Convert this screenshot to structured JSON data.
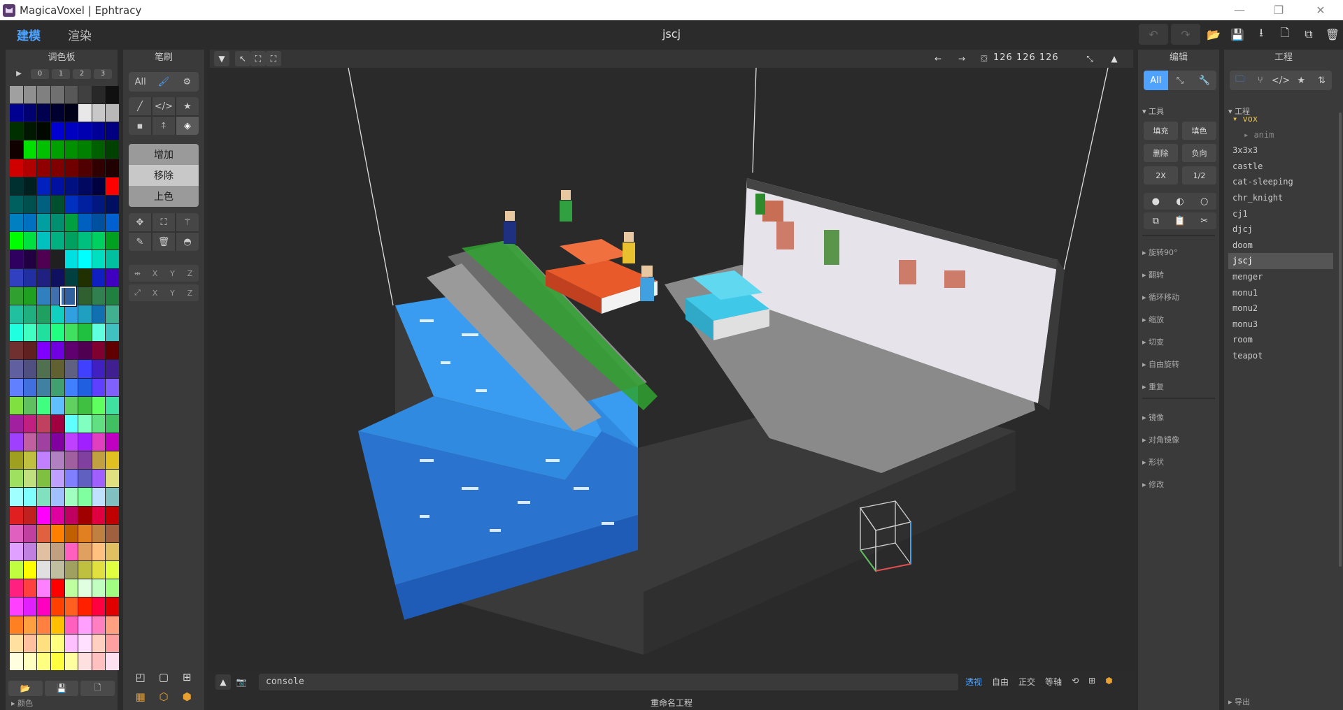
{
  "window": {
    "title": "MagicaVoxel | Ephtracy",
    "controls": [
      "—",
      "❐",
      "✕"
    ]
  },
  "topbar": {
    "tabs": [
      {
        "label": "建模",
        "active": true
      },
      {
        "label": "渲染",
        "active": false
      }
    ],
    "project_name": "jscj",
    "actions": [
      "↶",
      "↷",
      "📂",
      "💾",
      "⭳",
      "🗋",
      "⧉",
      "🗑"
    ]
  },
  "palette": {
    "title": "调色板",
    "tabs": [
      "▶",
      "0",
      "1",
      "2",
      "3"
    ],
    "footer_label": "颜色",
    "bottom_icons": [
      "📂",
      "💾",
      "🗋"
    ],
    "colors": [
      "#a0a0a0",
      "#909090",
      "#808080",
      "#707070",
      "#585858",
      "#404040",
      "#282828",
      "#101010",
      "#000090",
      "#000070",
      "#000050",
      "#000030",
      "#000018",
      "#e8e8e8",
      "#c8c8c8",
      "#b8b8b8",
      "#003000",
      "#001800",
      "#000800",
      "#0000d0",
      "#0000c0",
      "#0000b0",
      "#000098",
      "#000080",
      "#100000",
      "#00e000",
      "#00c000",
      "#00a000",
      "#009000",
      "#008000",
      "#006000",
      "#004000",
      "#d00000",
      "#b00000",
      "#900000",
      "#800000",
      "#700000",
      "#500000",
      "#300000",
      "#200000",
      "#003030",
      "#002020",
      "#0020c0",
      "#0010a0",
      "#001080",
      "#000860",
      "#000040",
      "#ff0000",
      "#006060",
      "#005050",
      "#006080",
      "#005030",
      "#0030c0",
      "#0020a0",
      "#001880",
      "#001060",
      "#0080c0",
      "#0070c0",
      "#00a0a0",
      "#009070",
      "#00a040",
      "#0060c0",
      "#0050a0",
      "#0060d0",
      "#00ff00",
      "#00e040",
      "#00c0c0",
      "#00b080",
      "#00a060",
      "#00c080",
      "#00d060",
      "#00a020",
      "#300060",
      "#200040",
      "#500050",
      "#202020",
      "#00e0e0",
      "#00ffff",
      "#00e0c0",
      "#00c0a0",
      "#3040c0",
      "#2030a0",
      "#202080",
      "#101060",
      "#004040",
      "#203000",
      "#1020c0",
      "#4000c0",
      "#30a030",
      "#20a020",
      "#3080c0",
      "#4070b0",
      "#3060a0",
      "#306030",
      "#308050",
      "#208040",
      "#20c0a0",
      "#20b080",
      "#20a060",
      "#10d0c0",
      "#30a0e0",
      "#20a0c0",
      "#1070b0",
      "#40b090",
      "#20ffe0",
      "#40ffc0",
      "#20e0a0",
      "#20ff80",
      "#40e060",
      "#20c040",
      "#60ffe0",
      "#40c0c0",
      "#703030",
      "#602020",
      "#8000ff",
      "#7000e0",
      "#600070",
      "#500050",
      "#800030",
      "#600000",
      "#6060a0",
      "#505080",
      "#507050",
      "#606030",
      "#606080",
      "#4040ff",
      "#4020c0",
      "#402090",
      "#6080ff",
      "#4070e0",
      "#4080a0",
      "#40a070",
      "#4080ff",
      "#2060e0",
      "#6040ff",
      "#8060ff",
      "#80e040",
      "#60c060",
      "#40ff80",
      "#60c0ff",
      "#60d060",
      "#40c040",
      "#60ff60",
      "#40e0a0",
      "#a020a0",
      "#c02080",
      "#c04060",
      "#a00040",
      "#60ffff",
      "#80ffc0",
      "#60e080",
      "#40c060",
      "#a040ff",
      "#c060a0",
      "#a040a0",
      "#8000a0",
      "#c040ff",
      "#a020ff",
      "#e040c0",
      "#c000c0",
      "#a0a020",
      "#c0c040",
      "#c080ff",
      "#b080c0",
      "#a060a0",
      "#8040a0",
      "#c0a040",
      "#e0c020",
      "#a0e060",
      "#c0e080",
      "#80c040",
      "#c0a0ff",
      "#8080ff",
      "#6060c0",
      "#a060ff",
      "#e0e080",
      "#a0ffff",
      "#80ffff",
      "#80e0c0",
      "#a0c0ff",
      "#a0ffc0",
      "#80ffa0",
      "#c0e0ff",
      "#80c0c0",
      "#e02020",
      "#c02020",
      "#ff00ff",
      "#e000a0",
      "#c00060",
      "#a00000",
      "#e00040",
      "#c00000",
      "#e060c0",
      "#c040a0",
      "#e06040",
      "#ff8000",
      "#c06000",
      "#e08020",
      "#c08040",
      "#a06040",
      "#e0a0ff",
      "#c080e0",
      "#e0c0a0",
      "#c0a080",
      "#ff60c0",
      "#e0a060",
      "#ffc080",
      "#e0c060",
      "#c0ff40",
      "#ffff00",
      "#e0e0e0",
      "#c0c0a0",
      "#a0a060",
      "#c0c040",
      "#e0e040",
      "#e0ff40",
      "#ff2080",
      "#ff4040",
      "#ff80ff",
      "#ff0000",
      "#c0ffa0",
      "#e0ffe0",
      "#c0ffc0",
      "#a0ff80",
      "#ff40ff",
      "#e020ff",
      "#ff00c0",
      "#ff4000",
      "#ff6020",
      "#ff2000",
      "#ff0040",
      "#e00000",
      "#ff8020",
      "#ffa040",
      "#ff8040",
      "#ffc000",
      "#ff60c0",
      "#ffa0ff",
      "#ff80c0",
      "#ffa080",
      "#ffe0a0",
      "#ffc0a0",
      "#ffe080",
      "#ffff80",
      "#ffc0ff",
      "#ffe0ff",
      "#ffd0c0",
      "#ffa0a0",
      "#ffffe0",
      "#ffffc0",
      "#ffff80",
      "#ffff40",
      "#ffffa0",
      "#ffe0e0",
      "#ffc0c0",
      "#ffe0f0"
    ]
  },
  "brush": {
    "title": "笔刷",
    "filter": [
      "All",
      "🖌",
      "⚙"
    ],
    "shapes": [
      "╱",
      "</>",
      "★",
      "▪",
      "⍏",
      "◈"
    ],
    "modes": [
      {
        "label": "增加",
        "color": "#9a9a9a"
      },
      {
        "label": "移除",
        "color": "#c8c8c8"
      },
      {
        "label": "上色",
        "color": "#9a9a9a"
      }
    ],
    "tools": [
      "✥",
      "⛶",
      "⚚",
      "✎",
      "🗑",
      "◓"
    ],
    "mirror_row": [
      "⇹",
      "X",
      "Y",
      "Z"
    ],
    "axis_row": [
      "⤢",
      "X",
      "Y",
      "Z"
    ],
    "bottom_tools": [
      "◰",
      "▢",
      "⊞",
      "▦",
      "⬡",
      "⬢"
    ]
  },
  "viewport": {
    "dims": "126  126  126",
    "left_tools": [
      "▼",
      "↖",
      "⛶",
      "⛶"
    ],
    "right_tools": [
      "←",
      "→",
      "⛋",
      "⤡",
      "▲"
    ]
  },
  "bottom": {
    "console_placeholder": "console",
    "view_modes": [
      {
        "label": "透视",
        "active": true
      },
      {
        "label": "自由",
        "active": false
      },
      {
        "label": "正交",
        "active": false
      },
      {
        "label": "等轴",
        "active": false
      }
    ],
    "status": "重命名工程"
  },
  "edit": {
    "title": "编辑",
    "filter": [
      "All",
      "⤡",
      "🔧"
    ],
    "tools_header": "▾ 工具",
    "tools": [
      "填充",
      "填色",
      "删除",
      "负向",
      "2X",
      "1/2"
    ],
    "icon_row1": [
      "●",
      "◐",
      "○"
    ],
    "icon_row2": [
      "⧉",
      "📋",
      "✂"
    ],
    "sections1": [
      "▸ 旋转90°",
      "▸ 翻转",
      "▸ 循环移动",
      "▸ 缩放",
      "▸ 切变",
      "▸ 自由旋转",
      "▸ 重复"
    ],
    "sections2": [
      "▸ 镜像",
      "▸ 对角镜像",
      "▸ 形状",
      "▸ 修改"
    ]
  },
  "project": {
    "title": "工程",
    "filter": [
      "🗀",
      "⑂",
      "</>",
      "★",
      "⇅"
    ],
    "tree_header": "▾ 工程",
    "footer": "▸ 导出",
    "items": [
      {
        "label": "▾ vox",
        "kind": "folder"
      },
      {
        "label": "▸ anim",
        "kind": "sub"
      },
      {
        "label": "3x3x3",
        "kind": "file"
      },
      {
        "label": "castle",
        "kind": "file"
      },
      {
        "label": "cat-sleeping",
        "kind": "file"
      },
      {
        "label": "chr_knight",
        "kind": "file"
      },
      {
        "label": "cj1",
        "kind": "file"
      },
      {
        "label": "djcj",
        "kind": "file"
      },
      {
        "label": "doom",
        "kind": "file"
      },
      {
        "label": "jscj",
        "kind": "file",
        "selected": true
      },
      {
        "label": "menger",
        "kind": "file"
      },
      {
        "label": "monu1",
        "kind": "file"
      },
      {
        "label": "monu2",
        "kind": "file"
      },
      {
        "label": "monu3",
        "kind": "file"
      },
      {
        "label": "room",
        "kind": "file"
      },
      {
        "label": "teapot",
        "kind": "file"
      }
    ]
  },
  "colors": {
    "accent": "#4fa3ff",
    "panel": "#3a3a3a",
    "background": "#2b2b2b",
    "folder": "#e8c547"
  }
}
